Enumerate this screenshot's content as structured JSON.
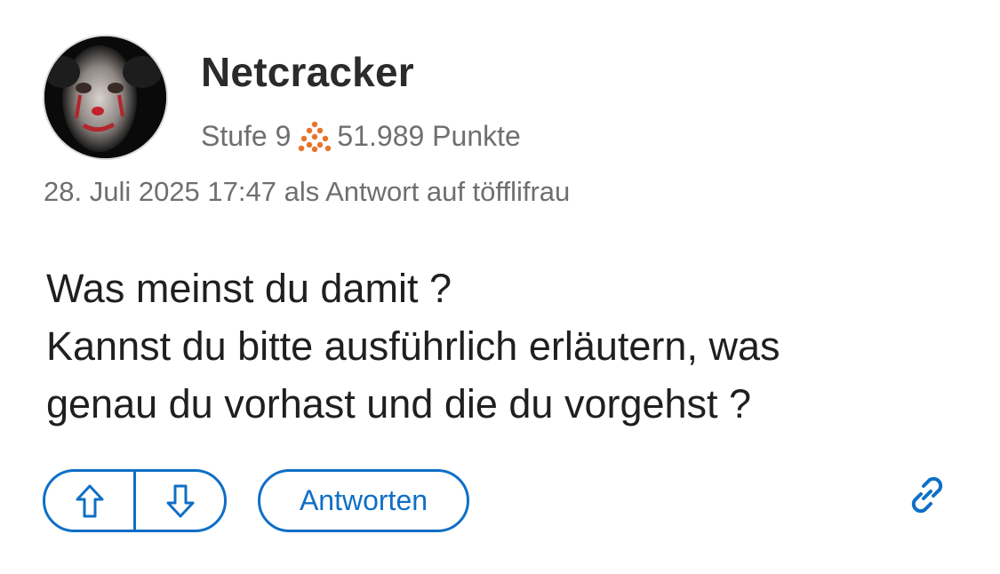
{
  "post": {
    "author": {
      "name": "Netcracker",
      "level_label": "Stufe 9",
      "points_label": "51.989 Punkte",
      "avatar_icon": "clown-avatar-icon",
      "level_icon": "level-dots-icon"
    },
    "meta_text": "28. Juli 2025 17:47 als Antwort auf töfflifrau",
    "body_lines": [
      "Was meinst du damit ?",
      "Kannst du bitte ausführlich erläutern, was",
      "genau du vorhast und die du vorgehst ?"
    ]
  },
  "actions": {
    "upvote_icon": "arrow-up-icon",
    "downvote_icon": "arrow-down-icon",
    "reply_label": "Antworten",
    "link_icon": "link-icon"
  },
  "colors": {
    "accent": "#0f6fc6",
    "level_icon": "#e8742c",
    "muted_text": "#6f6f6f"
  }
}
